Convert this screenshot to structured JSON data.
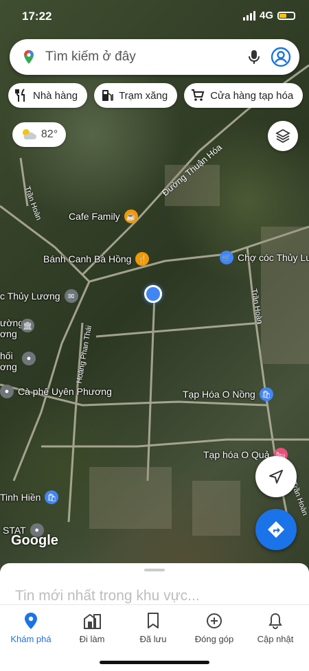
{
  "status": {
    "time": "17:22",
    "network": "4G"
  },
  "search": {
    "placeholder": "Tìm kiếm ở đây"
  },
  "chips": [
    {
      "label": "Nhà hàng",
      "icon": "fork-knife-icon"
    },
    {
      "label": "Trạm xăng",
      "icon": "gas-station-icon"
    },
    {
      "label": "Cửa hàng tạp hóa",
      "icon": "cart-icon"
    }
  ],
  "weather": {
    "temp": "82°",
    "icon": "partly-cloudy-icon"
  },
  "map": {
    "roads": [
      "Đường Thuận Hóa",
      "Trần Hoàn",
      "Trần Hoàn",
      "Hoàng Phan Thái",
      "Trần Hoàn"
    ],
    "places": [
      "Cafe Family",
      "Bánh Canh Bà Hồng",
      "Chợ cóc Thủy Lương",
      "c Thủy Lương",
      "ường",
      "ơng",
      "hối",
      "ơng",
      "Cà phê Uyên Phương",
      "Tạp Hóa O Nồng",
      "Tạp hóa O Quả",
      "Tinh Hiền",
      "STAT"
    ],
    "logo": "Google"
  },
  "sheet": {
    "title": "Tin mới nhất trong khu vực..."
  },
  "tabs": [
    {
      "label": "Khám phá",
      "icon": "explore-pin-icon",
      "active": true
    },
    {
      "label": "Đi làm",
      "icon": "commute-icon",
      "active": false
    },
    {
      "label": "Đã lưu",
      "icon": "bookmark-icon",
      "active": false
    },
    {
      "label": "Đóng góp",
      "icon": "add-circle-icon",
      "active": false
    },
    {
      "label": "Cập nhật",
      "icon": "bell-icon",
      "active": false
    }
  ],
  "colors": {
    "accent": "#1a73e8",
    "poi_food": "#f29900",
    "poi_shop": "#4285f4",
    "poi_gray": "#70757a"
  }
}
